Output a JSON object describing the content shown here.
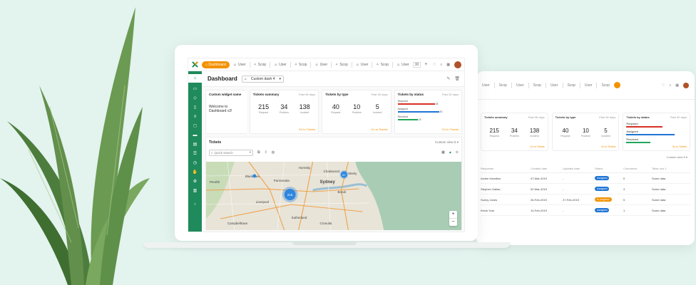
{
  "colors": {
    "accent": "#f39200",
    "sidebar": "#1f8a5b",
    "required": "#d93025",
    "assigned": "#1e74d6",
    "resolved": "#1fa659",
    "cluster": "#2e86de"
  },
  "topbar": {
    "dashboard_label": "Dashboard",
    "tabs": [
      "User",
      "Scop",
      "User",
      "Scop",
      "User",
      "Scop",
      "User",
      "Scop",
      "User"
    ],
    "page_count": "30",
    "add_label": "+"
  },
  "page": {
    "title": "Dashboard",
    "dropdown_value": "Custom dash 4"
  },
  "widgets": {
    "custom": {
      "title": "Custom widget name",
      "welcome": "Welcome to Dashboard v2!"
    },
    "summary": {
      "title": "Tickets summary",
      "period": "Past 96 days",
      "values": [
        "215",
        "34",
        "138"
      ],
      "labels": [
        "Request",
        "Problem",
        "Incident"
      ],
      "link": "Go to Tickets"
    },
    "by_type": {
      "title": "Tickets by type",
      "period": "Past 30 days",
      "values": [
        "40",
        "10",
        "5"
      ],
      "labels": [
        "Request",
        "Problem",
        "Incident"
      ],
      "link": "Go to Tickets"
    },
    "by_status": {
      "title": "Tickets by status",
      "period": "Past 30 days",
      "items": [
        {
          "label": "Required",
          "value": "38"
        },
        {
          "label": "Assigned",
          "value": "30"
        },
        {
          "label": "Resolved",
          "value": "15"
        }
      ],
      "link": "Go to Tickets"
    }
  },
  "tickets": {
    "title": "Tickets",
    "view": "Custom view 5",
    "search_placeholder": "Quick search"
  },
  "map": {
    "labels": [
      "Sydney",
      "Parramatta",
      "Blacktown",
      "Liverpool",
      "Manly",
      "Bondi",
      "Cronulla",
      "Penrith",
      "Hornsby",
      "Campbelltown",
      "Sutherland",
      "Chatswood"
    ],
    "clusters": [
      "215",
      "87"
    ]
  },
  "tablet": {
    "tabs": [
      "User",
      "Scop",
      "User",
      "Scop",
      "User",
      "Scop",
      "User",
      "Scop"
    ],
    "summary": {
      "title": "Tickets summary",
      "period": "Past 96 days",
      "values": [
        "215",
        "34",
        "138"
      ],
      "labels": [
        "Request",
        "Problem",
        "Incident"
      ]
    },
    "by_type": {
      "title": "Tickets by type",
      "period": "Past 30 days",
      "values": [
        "40",
        "10",
        "5"
      ],
      "labels": [
        "Request",
        "Problem",
        "Incident"
      ]
    },
    "by_status": {
      "title": "Tickets by status",
      "period": "Past 30 days",
      "items": [
        "Required",
        "Assigned",
        "Resolved"
      ]
    },
    "link": "Go to Tickets",
    "view": "Custom view 5",
    "columns": [
      "Requester",
      "Created date",
      "Updated date",
      "Status",
      "Comments",
      "Table row 1"
    ],
    "rows": [
      {
        "name": "Archie Hamilton",
        "created": "07-Mar-2019",
        "updated": "-",
        "status": "Assigned",
        "comments": "0",
        "data": "Some data"
      },
      {
        "name": "Stephen Gallas",
        "created": "02-Mar-2019",
        "updated": "-",
        "status": "Assigned",
        "comments": "3",
        "data": "Some data"
      },
      {
        "name": "Sonny Jones",
        "created": "26-Feb-2019",
        "updated": "27-Feb-2019",
        "status": "In progress",
        "comments": "5",
        "data": "Some data"
      },
      {
        "name": "Kevin Yost",
        "created": "14-Feb-2019",
        "updated": "-",
        "status": "Assigned",
        "comments": "1",
        "data": "Some data"
      }
    ]
  }
}
